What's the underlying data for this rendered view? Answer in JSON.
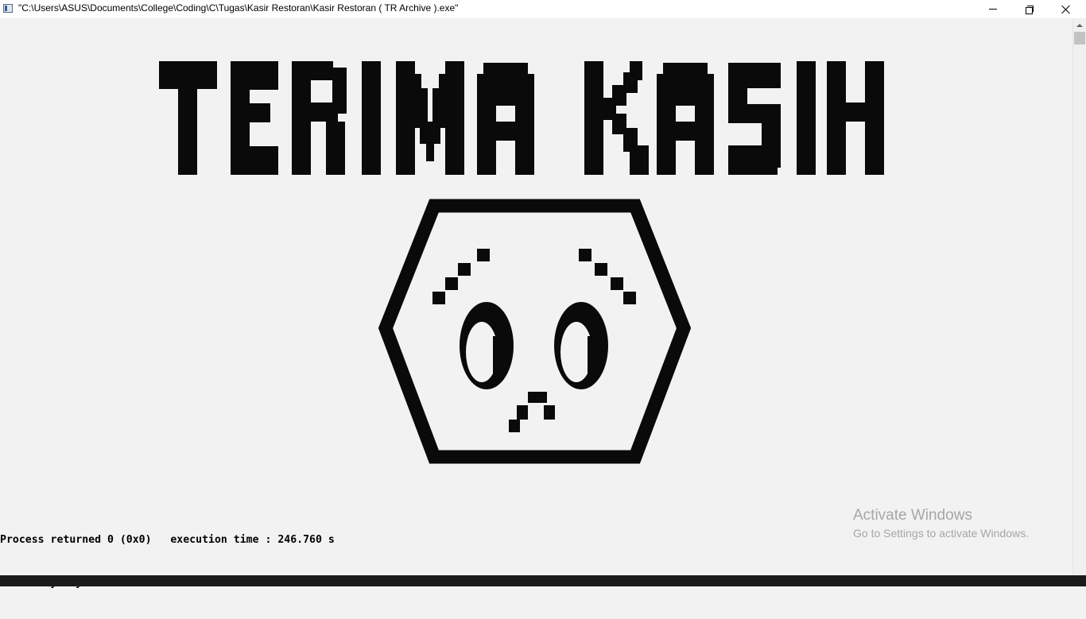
{
  "window": {
    "title": "\"C:\\Users\\ASUS\\Documents\\College\\Coding\\C\\Tugas\\Kasir Restoran\\Kasir Restoran ( TR Archive ).exe\"",
    "app_icon": "console-app-icon",
    "buttons": {
      "minimize_icon": "minimize-icon",
      "maximize_icon": "restore-icon",
      "close_icon": "close-icon"
    }
  },
  "console": {
    "banner_text": "TERIMA KASIH",
    "art_icon": "pixel-face-icon",
    "lines": [
      "Process returned 0 (0x0)   execution time : 246.760 s",
      "Press any key to continue."
    ],
    "text_color": "#000000",
    "background_color": "#f2f2f2"
  },
  "watermark": {
    "title": "Activate Windows",
    "subtitle": "Go to Settings to activate Windows.",
    "color": "#a6a6a6"
  }
}
